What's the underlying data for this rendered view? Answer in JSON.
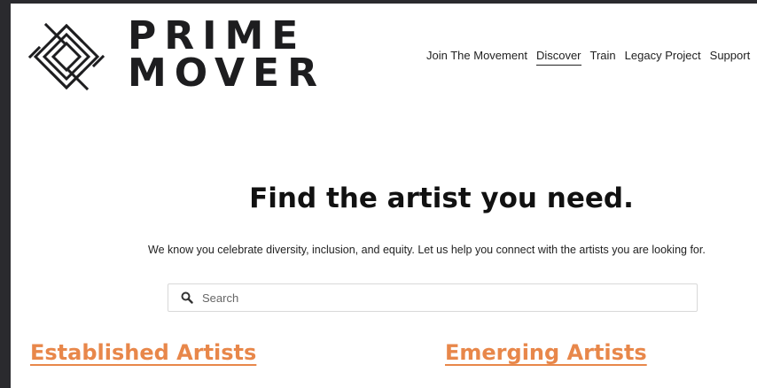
{
  "brand": {
    "line1": "PRIME",
    "line2": "MOVER",
    "logo_icon": "prime-mover-logo-icon"
  },
  "nav": {
    "items": [
      "Join The Movement",
      "Discover",
      "Train",
      "Legacy Project",
      "Support"
    ],
    "active": "Discover"
  },
  "hero": {
    "title": "Find the artist you need.",
    "subtitle": "We know you celebrate diversity, inclusion, and equity.  Let us help you connect with the artists you are looking for."
  },
  "search": {
    "placeholder": "Search",
    "value": "",
    "icon": "search-icon"
  },
  "categories": {
    "left": "Established Artists",
    "right": "Emerging Artists"
  },
  "colors": {
    "accent": "#e8874a",
    "text": "#1d1d1f",
    "background": "#ffffff"
  }
}
